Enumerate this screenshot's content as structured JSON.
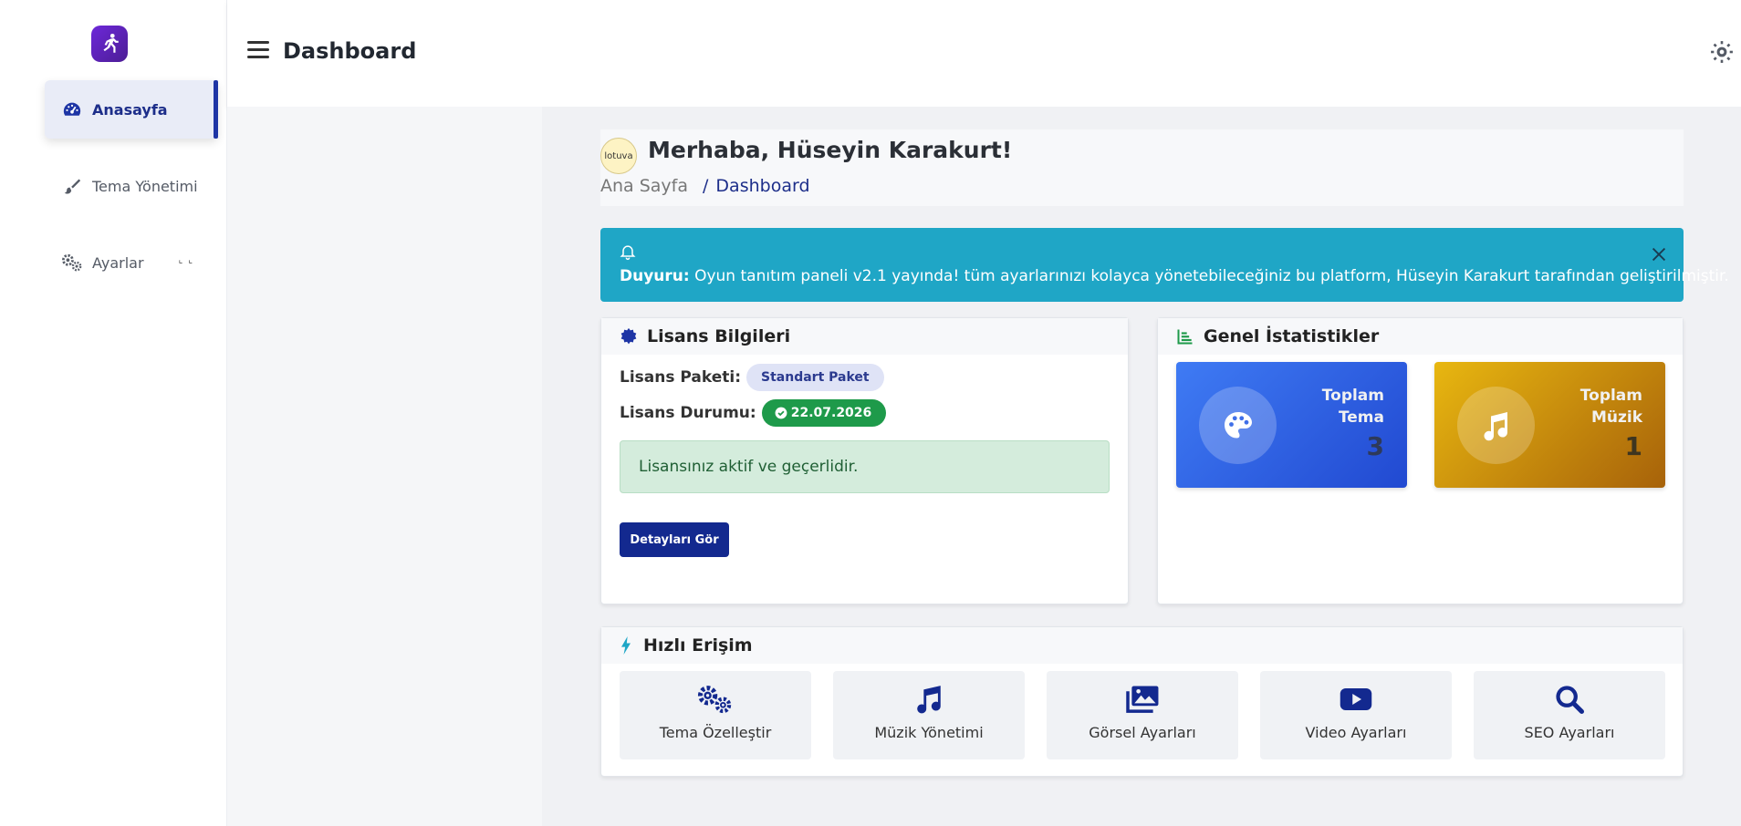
{
  "sidebar": {
    "items": [
      {
        "label": "Anasayfa",
        "icon": "dashboard-gauge-icon",
        "active": true
      },
      {
        "label": "Tema Yönetimi",
        "icon": "brush-icon",
        "active": false
      },
      {
        "label": "Ayarlar",
        "icon": "gears-icon",
        "active": false
      }
    ]
  },
  "header": {
    "title": "Dashboard"
  },
  "greeting": {
    "avatar_text": "lotuva",
    "title": "Merhaba, Hüseyin Karakurt!",
    "breadcrumb": {
      "home": "Ana Sayfa",
      "separator": "/",
      "current": "Dashboard"
    }
  },
  "alert": {
    "prefix": "Duyuru:",
    "message": " Oyun tanıtım paneli v2.1 yayında! tüm ayarlarınızı kolayca yönetebileceğiniz bu platform, Hüseyin Karakurt tarafından geliştirilmiştir.",
    "color": "#1fa6c6"
  },
  "license": {
    "title": "Lisans Bilgileri",
    "package_label": "Lisans Paketi:",
    "package_value": "Standart Paket",
    "status_label": "Lisans Durumu:",
    "status_value": "22.07.2026",
    "status_message": "Lisansınız aktif ve geçerlidir.",
    "details_button": "Detayları Gör"
  },
  "stats": {
    "title": "Genel İstatistikler",
    "cards": [
      {
        "label_line1": "Toplam",
        "label_line2": "Tema",
        "value": "3",
        "icon": "palette-icon"
      },
      {
        "label_line1": "Toplam",
        "label_line2": "Müzik",
        "value": "1",
        "icon": "music-note-icon"
      }
    ]
  },
  "quick_access": {
    "title": "Hızlı Erişim",
    "items": [
      {
        "label": "Tema Özelleştir",
        "icon": "gears-icon"
      },
      {
        "label": "Müzik Yönetimi",
        "icon": "music-note-icon"
      },
      {
        "label": "Görsel Ayarları",
        "icon": "images-icon"
      },
      {
        "label": "Video Ayarları",
        "icon": "youtube-icon"
      },
      {
        "label": "SEO Ayarları",
        "icon": "search-icon"
      }
    ]
  },
  "colors": {
    "primary": "#13298f",
    "accent_blue": "#3f7bf4",
    "accent_gold": "#e8b710",
    "success": "#1e9a4a",
    "brand": "#6d28d9"
  }
}
